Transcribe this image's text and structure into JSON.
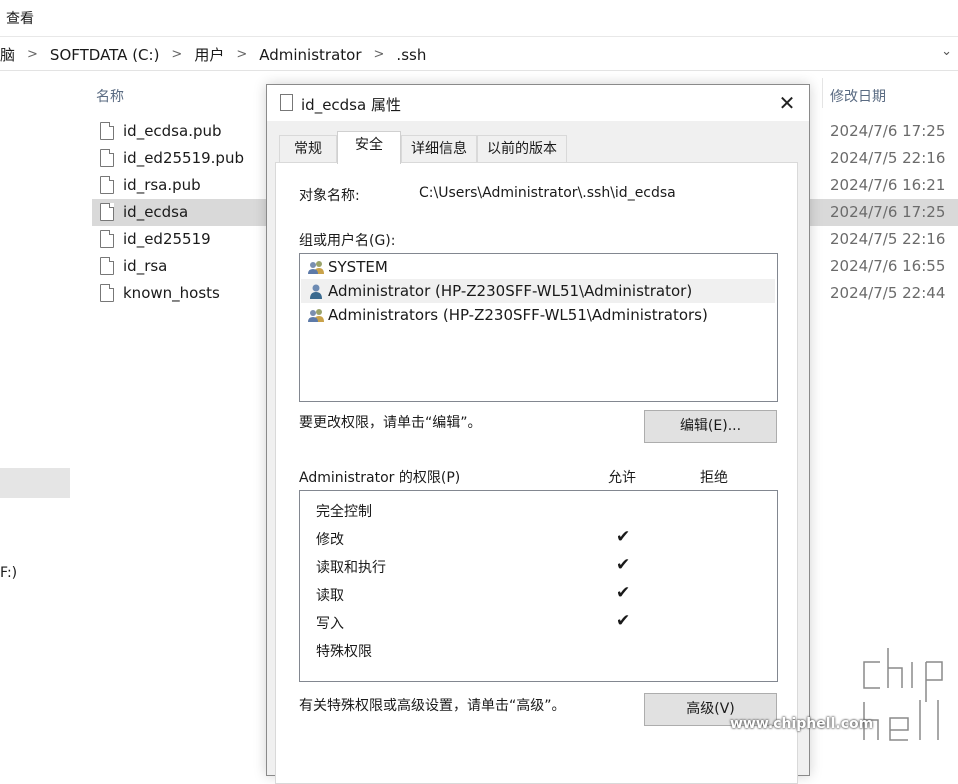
{
  "menubar": {
    "view": "查看"
  },
  "address": {
    "crumbs": [
      "脑",
      "SOFTDATA (C:)",
      "用户",
      "Administrator",
      ".ssh"
    ],
    "dropdown_icon": "chevron-down-icon"
  },
  "leftpane": {
    "drive_label": "F:)"
  },
  "filelist": {
    "headers": {
      "name": "名称",
      "date": "修改日期"
    },
    "files": [
      {
        "name": "id_ecdsa.pub",
        "date": "2024/7/6 17:25"
      },
      {
        "name": "id_ed25519.pub",
        "date": "2024/7/5 22:16"
      },
      {
        "name": "id_rsa.pub",
        "date": "2024/7/6 16:21"
      },
      {
        "name": "id_ecdsa",
        "date": "2024/7/6 17:25"
      },
      {
        "name": "id_ed25519",
        "date": "2024/7/5 22:16"
      },
      {
        "name": "id_rsa",
        "date": "2024/7/6 16:55"
      },
      {
        "name": "known_hosts",
        "date": "2024/7/5 22:44"
      }
    ],
    "selected_index": 3
  },
  "dialog": {
    "title": "id_ecdsa 属性",
    "close": "✕",
    "tabs": [
      "常规",
      "安全",
      "详细信息",
      "以前的版本"
    ],
    "active_tab": 1,
    "object_label": "对象名称:",
    "object_value": "C:\\Users\\Administrator\\.ssh\\id_ecdsa",
    "group_label": "组或用户名(G):",
    "users": [
      {
        "name": "SYSTEM",
        "icon": "users-group-icon"
      },
      {
        "name": "Administrator (HP-Z230SFF-WL51\\Administrator)",
        "icon": "user-icon"
      },
      {
        "name": "Administrators (HP-Z230SFF-WL51\\Administrators)",
        "icon": "users-group-icon"
      }
    ],
    "selected_user": 1,
    "edit_hint": "要更改权限，请单击“编辑”。",
    "edit_button": "编辑(E)...",
    "perm_title": "Administrator 的权限(P)",
    "allow_header": "允许",
    "deny_header": "拒绝",
    "permissions": [
      {
        "name": "完全控制",
        "allow": false,
        "deny": false
      },
      {
        "name": "修改",
        "allow": true,
        "deny": false
      },
      {
        "name": "读取和执行",
        "allow": true,
        "deny": false
      },
      {
        "name": "读取",
        "allow": true,
        "deny": false
      },
      {
        "name": "写入",
        "allow": true,
        "deny": false
      },
      {
        "name": "特殊权限",
        "allow": false,
        "deny": false
      }
    ],
    "check_glyph": "✔",
    "advanced_hint": "有关特殊权限或高级设置，请单击“高级”。",
    "advanced_button": "高级(V)"
  },
  "watermark": {
    "text": "www.chiphell.com",
    "logo": "chiphell"
  }
}
